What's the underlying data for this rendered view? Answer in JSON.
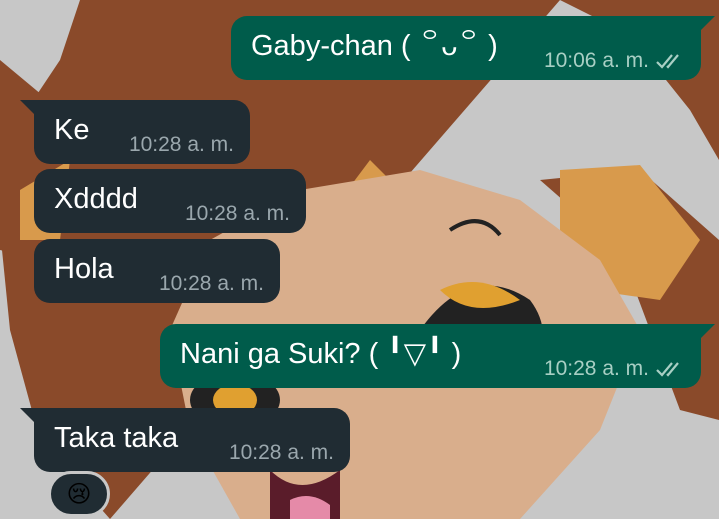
{
  "messages": [
    {
      "id": "m1",
      "direction": "out",
      "text": "Gaby-chan ( ꒪ᴗ꒪ )",
      "time": "10:06 a. m.",
      "status": "read",
      "tail": true
    },
    {
      "id": "m2",
      "direction": "in",
      "text": "Ke",
      "time": "10:28 a. m.",
      "tail": true
    },
    {
      "id": "m3",
      "direction": "in",
      "text": "Xdddd",
      "time": "10:28 a. m.",
      "tail": false
    },
    {
      "id": "m4",
      "direction": "in",
      "text": "Hola",
      "time": "10:28 a. m.",
      "tail": false
    },
    {
      "id": "m5",
      "direction": "out",
      "text": "Nani ga Suki? ( ╹▽╹ )",
      "time": "10:28 a. m.",
      "status": "read",
      "tail": true
    },
    {
      "id": "m6",
      "direction": "in",
      "text": "Taka taka",
      "time": "10:28 a. m.",
      "tail": true
    }
  ],
  "reaction": {
    "emoji": "😢",
    "on_message": "m6"
  },
  "theme": {
    "incoming_bubble": "#202c33",
    "outgoing_bubble": "#005c4b",
    "timestamp_in": "#9aa7ad",
    "timestamp_out": "#a8cfc4",
    "read_ticks": "#a8cfc4"
  }
}
